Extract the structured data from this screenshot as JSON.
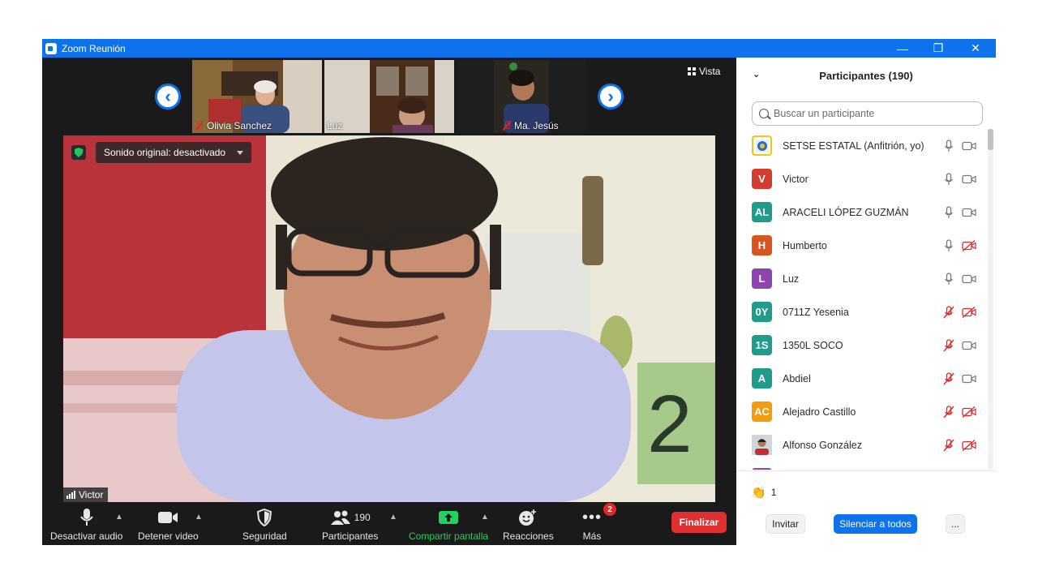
{
  "window": {
    "title": "Zoom Reunión",
    "controls": {
      "minimize": "—",
      "restore": "❐",
      "close": "✕"
    }
  },
  "strip": {
    "thumbnails": [
      {
        "name": "Olivia Sanchez",
        "muted": true
      },
      {
        "name": "Luz",
        "muted": false
      },
      {
        "name": "Ma. Jesús",
        "muted": true
      }
    ],
    "prev_label": "‹",
    "next_label": "›",
    "view_label": "Vista"
  },
  "main_video": {
    "sound_setting": "Sonido original: desactivado",
    "speaker_name": "Victor"
  },
  "toolbar": {
    "mute_label": "Desactivar audio",
    "video_label": "Detener video",
    "security_label": "Seguridad",
    "participants_label": "Participantes",
    "participants_count": "190",
    "share_label": "Compartir pantalla",
    "reactions_label": "Reacciones",
    "more_label": "Más",
    "more_badge": "2",
    "end_label": "Finalizar"
  },
  "panel": {
    "title": "Participantes (190)",
    "search_placeholder": "Buscar un participante",
    "participants": [
      {
        "initials": "",
        "name": "SETSE ESTATAL (Anfitrión, yo)",
        "color": "#f0c419",
        "avatar_type": "logo",
        "mic": "on",
        "video": "on"
      },
      {
        "initials": "V",
        "name": "Victor",
        "color": "#d63b2f",
        "avatar_type": "initials",
        "mic": "on",
        "video": "on"
      },
      {
        "initials": "AL",
        "name": "ARACELI LÓPEZ GUZMÁN",
        "color": "#1f9d8a",
        "avatar_type": "initials",
        "mic": "on",
        "video": "on"
      },
      {
        "initials": "H",
        "name": "Humberto",
        "color": "#d9541e",
        "avatar_type": "initials",
        "mic": "on",
        "video": "off"
      },
      {
        "initials": "L",
        "name": "Luz",
        "color": "#8e44ad",
        "avatar_type": "initials",
        "mic": "on",
        "video": "on"
      },
      {
        "initials": "0Y",
        "name": "0711Z Yesenia",
        "color": "#1f9d8a",
        "avatar_type": "initials",
        "mic": "off",
        "video": "off"
      },
      {
        "initials": "1S",
        "name": "1350L SOCO",
        "color": "#1f9d8a",
        "avatar_type": "initials",
        "mic": "off",
        "video": "on"
      },
      {
        "initials": "A",
        "name": "Abdiel",
        "color": "#1f9d8a",
        "avatar_type": "initials",
        "mic": "off",
        "video": "on"
      },
      {
        "initials": "AC",
        "name": "Alejadro Castillo",
        "color": "#f39c12",
        "avatar_type": "initials",
        "mic": "off",
        "video": "off"
      },
      {
        "initials": "",
        "name": "Alfonso González",
        "color": "#9b6b4a",
        "avatar_type": "photo",
        "mic": "off",
        "video": "off"
      }
    ],
    "reaction_count": "1",
    "invite_label": "Invitar",
    "mute_all_label": "Silenciar a todos",
    "more_label": "..."
  },
  "colors": {
    "accent": "#0e72ed",
    "end_red": "#e02f2f",
    "share_green": "#23d160",
    "muted_red": "#e02828"
  }
}
